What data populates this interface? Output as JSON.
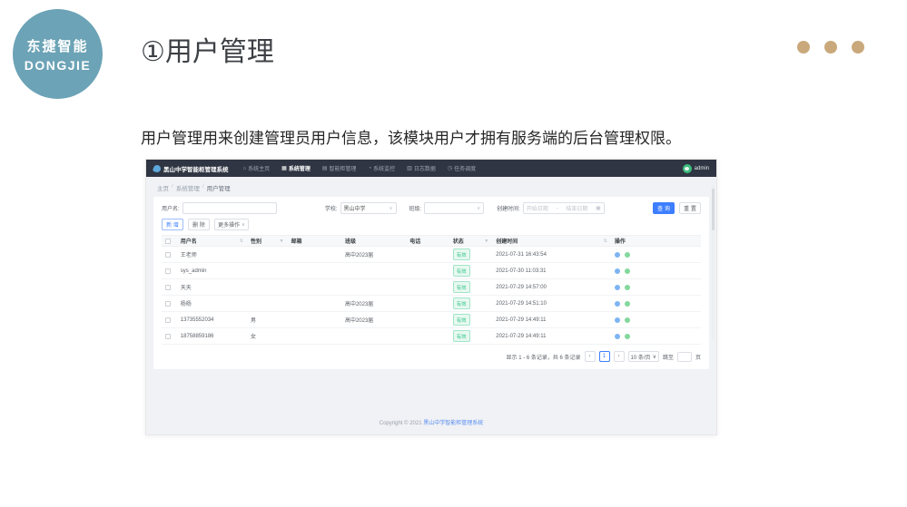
{
  "page": {
    "logo_line1": "东捷智能",
    "logo_line2": "DONGJIE",
    "title": "①用户管理",
    "description": "用户管理用来创建管理员用户信息，该模块用户才拥有服务端的后台管理权限。"
  },
  "colors": {
    "logo_circle": "#6CA3B6",
    "dot_tan": "#C9A97B",
    "navbar_bg": "#2F3542",
    "accent_blue": "#3D7EFF",
    "status_green": "#39C692"
  },
  "app": {
    "brand": "黑山中学智能柜管理系统",
    "nav": [
      {
        "label": "系统主页",
        "icon": "home-icon",
        "active": false
      },
      {
        "label": "系统管理",
        "icon": "grid-icon",
        "active": true
      },
      {
        "label": "智能柜管理",
        "icon": "cabinet-icon",
        "active": false
      },
      {
        "label": "系统监控",
        "icon": "monitor-icon",
        "active": false
      },
      {
        "label": "日志数据",
        "icon": "log-icon",
        "active": false
      },
      {
        "label": "任务调度",
        "icon": "clock-icon",
        "active": false
      }
    ],
    "user": "admin",
    "breadcrumb": {
      "home": "主页",
      "section": "系统管理",
      "current": "用户管理"
    },
    "filters": {
      "username_label": "用户名:",
      "school_label": "学校:",
      "school_value": "黑山中学",
      "class_label": "班级:",
      "class_value": "",
      "date_label": "创建时间:",
      "date_start_placeholder": "开始日期",
      "date_separator": "-",
      "date_end_placeholder": "结束日期",
      "search_button": "查 询",
      "reset_button": "重 置"
    },
    "actions": {
      "add": "新 增",
      "delete": "删 除",
      "more": "更多操作"
    },
    "table": {
      "columns": [
        "用户名",
        "性别",
        "邮箱",
        "班级",
        "电话",
        "状态",
        "创建时间",
        "操作"
      ],
      "rows": [
        {
          "username": "王老师",
          "gender": "",
          "email": "",
          "class": "高中2023届",
          "phone": "",
          "status": "有效",
          "created": "2021-07-31 16:43:54"
        },
        {
          "username": "sys_admin",
          "gender": "",
          "email": "",
          "class": "",
          "phone": "",
          "status": "有效",
          "created": "2021-07-30 11:03:31"
        },
        {
          "username": "天天",
          "gender": "",
          "email": "",
          "class": "",
          "phone": "",
          "status": "有效",
          "created": "2021-07-29 14:57:00"
        },
        {
          "username": "杨杨",
          "gender": "",
          "email": "",
          "class": "高中2023届",
          "phone": "",
          "status": "有效",
          "created": "2021-07-29 14:51:10"
        },
        {
          "username": "13735552034",
          "gender": "男",
          "email": "",
          "class": "高中2023届",
          "phone": "",
          "status": "有效",
          "created": "2021-07-29 14:49:11"
        },
        {
          "username": "18758859186",
          "gender": "女",
          "email": "",
          "class": "",
          "phone": "",
          "status": "有效",
          "created": "2021-07-29 14:49:11"
        }
      ]
    },
    "pagination": {
      "summary": "显示 1 - 6 条记录，共 6 条记录",
      "prev": "‹",
      "page": "1",
      "next": "›",
      "page_size": "10 条/页",
      "jump_label": "跳至",
      "jump_suffix": "页"
    },
    "footer": {
      "copyright_prefix": "Copyright © 2021 ",
      "copyright_link": "黑山中学智能柜管理系统"
    }
  }
}
